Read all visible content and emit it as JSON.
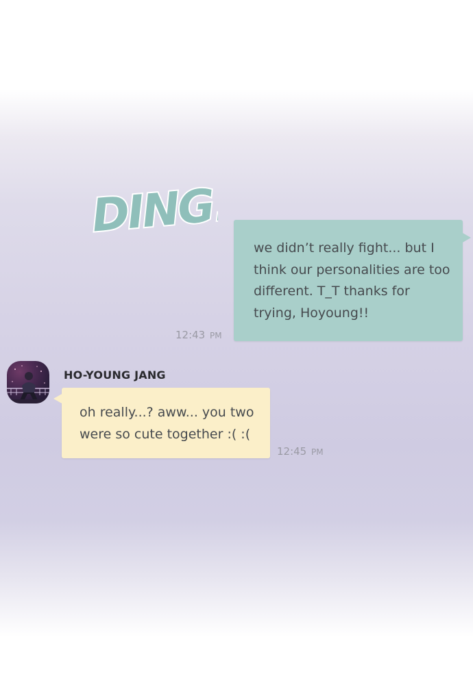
{
  "sound_effect": {
    "text": "DING!",
    "color": "#8fbfba"
  },
  "messages": [
    {
      "direction": "sent",
      "text": "we didn’t really fight... but I\nthink our personalities are too\ndifferent. T_T thanks for\ntrying, Hoyoung!!",
      "time": "12:43",
      "ampm": "PM",
      "bubble_color": "#a9cfca"
    },
    {
      "direction": "received",
      "sender": "HO-YOUNG JANG",
      "text": "oh really...? aww... you two\nwere so cute together :( :(",
      "time": "12:45",
      "ampm": "PM",
      "bubble_color": "#fbefc9"
    }
  ]
}
